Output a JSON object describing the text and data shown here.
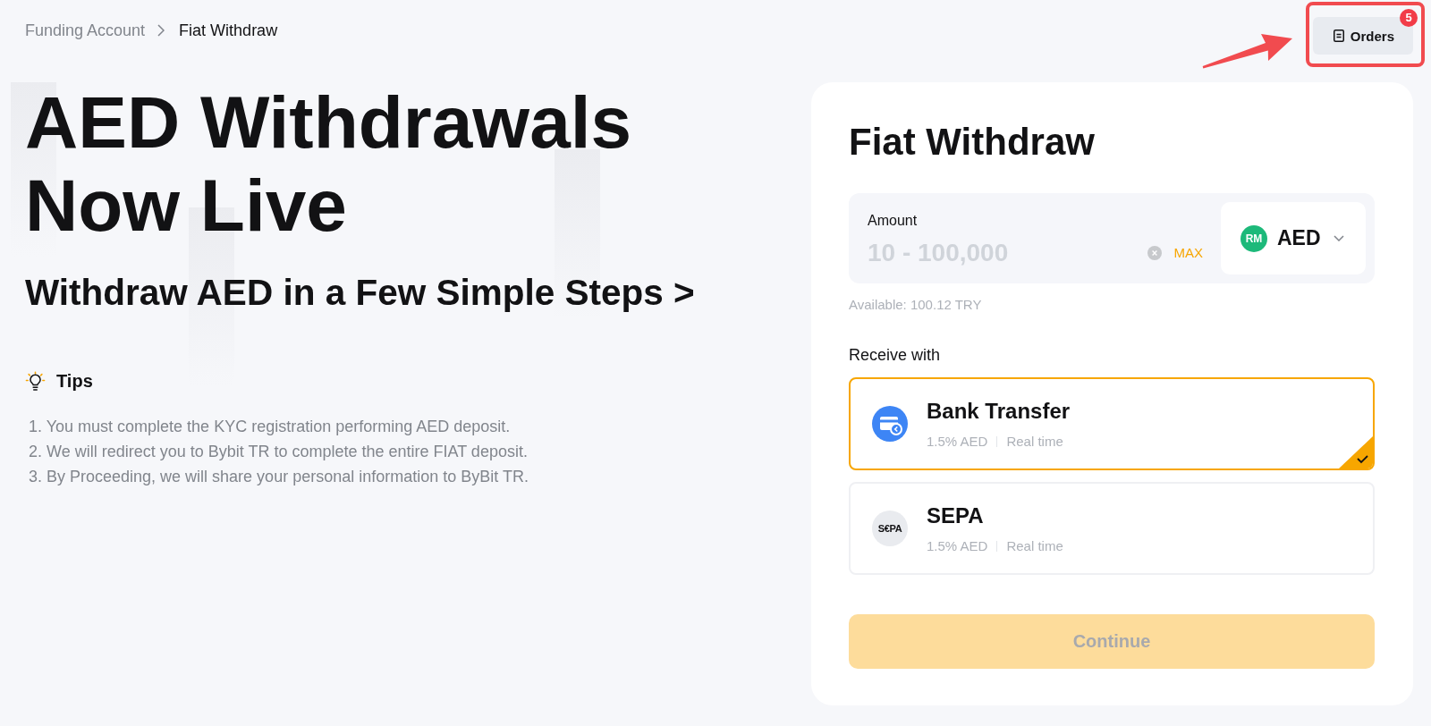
{
  "breadcrumb": [
    {
      "label": "Funding Account",
      "current": false
    },
    {
      "label": "Fiat Withdraw",
      "current": true
    }
  ],
  "orders_button": {
    "label": "Orders",
    "badge": "5"
  },
  "hero": {
    "title": "AED Withdrawals Now Live",
    "subtitle": "Withdraw AED in a Few Simple Steps >"
  },
  "tips": {
    "title": "Tips",
    "items": [
      "1. You must complete the KYC registration performing AED deposit.",
      "2. We will redirect you to Bybit TR to complete the entire FIAT deposit.",
      "3. By Proceeding, we will share your personal information to ByBit TR."
    ]
  },
  "card": {
    "title": "Fiat Withdraw",
    "amount": {
      "label": "Amount",
      "placeholder": "10 - 100,000",
      "max_label": "MAX"
    },
    "currency": {
      "badge": "RM",
      "code": "AED"
    },
    "available": "Available: 100.12 TRY",
    "receive_label": "Receive with",
    "methods": [
      {
        "kind": "bank",
        "name": "Bank Transfer",
        "fee": "1.5% AED",
        "speed": "Real time",
        "selected": true
      },
      {
        "kind": "sepa",
        "logo": "S€PA",
        "name": "SEPA",
        "fee": "1.5% AED",
        "speed": "Real time",
        "selected": false
      }
    ],
    "continue_button": {
      "label": "Continue",
      "disabled": true
    }
  }
}
